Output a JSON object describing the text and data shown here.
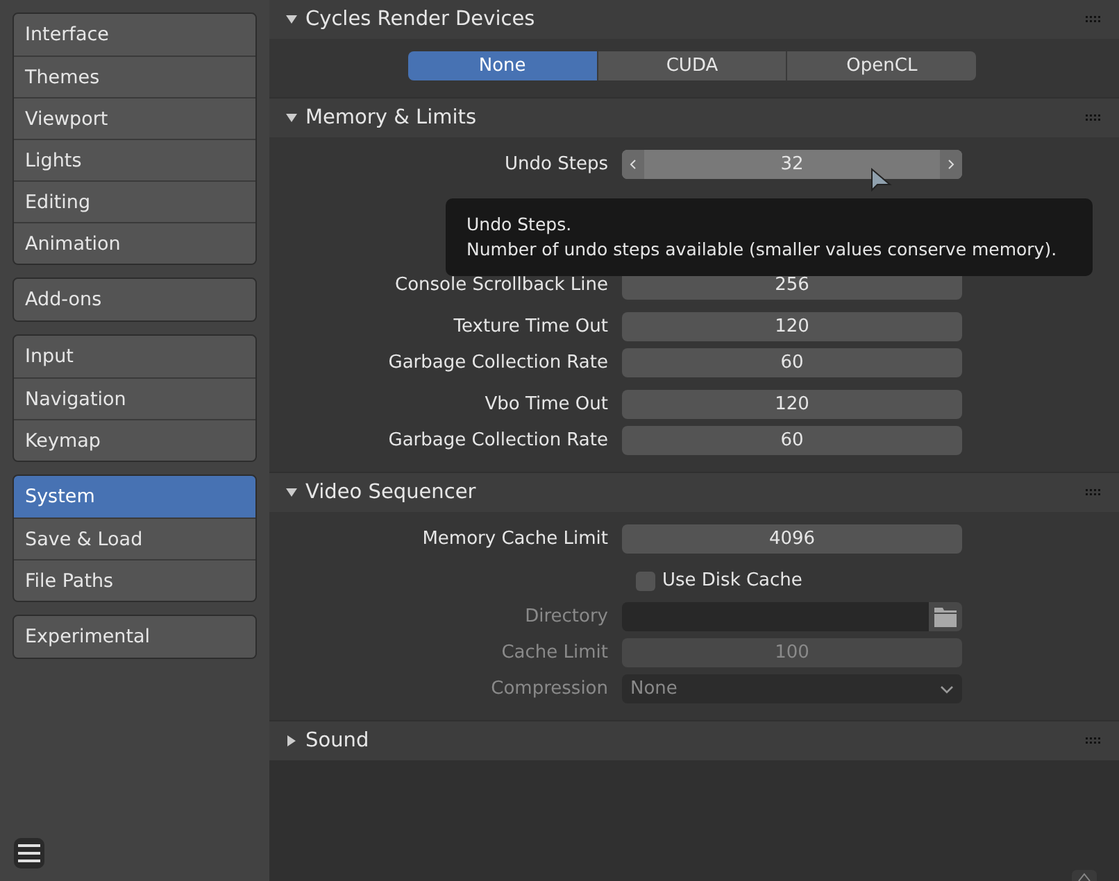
{
  "sidebar": {
    "groups": [
      [
        {
          "label": "Interface",
          "selected": false
        },
        {
          "label": "Themes",
          "selected": false
        },
        {
          "label": "Viewport",
          "selected": false
        },
        {
          "label": "Lights",
          "selected": false
        },
        {
          "label": "Editing",
          "selected": false
        },
        {
          "label": "Animation",
          "selected": false
        }
      ],
      [
        {
          "label": "Add-ons",
          "selected": false
        }
      ],
      [
        {
          "label": "Input",
          "selected": false
        },
        {
          "label": "Navigation",
          "selected": false
        },
        {
          "label": "Keymap",
          "selected": false
        }
      ],
      [
        {
          "label": "System",
          "selected": true
        },
        {
          "label": "Save & Load",
          "selected": false
        },
        {
          "label": "File Paths",
          "selected": false
        }
      ],
      [
        {
          "label": "Experimental",
          "selected": false
        }
      ]
    ]
  },
  "panels": [
    {
      "title": "Cycles Render Devices",
      "expanded": true,
      "groups": [
        [
          {
            "kind": "segmented",
            "options": [
              {
                "label": "None",
                "selected": true
              },
              {
                "label": "CUDA",
                "selected": false
              },
              {
                "label": "OpenCL",
                "selected": false
              }
            ]
          }
        ]
      ]
    },
    {
      "title": "Memory & Limits",
      "expanded": true,
      "groups": [
        [
          {
            "kind": "number",
            "label": "Undo Steps",
            "value": "32",
            "hovered": true,
            "disabled": false
          }
        ],
        [
          {
            "kind": "number",
            "label": "Console Scrollback Line",
            "value": "256",
            "hovered": false,
            "disabled": false
          }
        ],
        [
          {
            "kind": "number",
            "label": "Texture Time Out",
            "value": "120",
            "hovered": false,
            "disabled": false
          },
          {
            "kind": "number",
            "label": "Garbage Collection Rate",
            "value": "60",
            "hovered": false,
            "disabled": false
          }
        ],
        [
          {
            "kind": "number",
            "label": "Vbo Time Out",
            "value": "120",
            "hovered": false,
            "disabled": false
          },
          {
            "kind": "number",
            "label": "Garbage Collection Rate",
            "value": "60",
            "hovered": false,
            "disabled": false
          }
        ]
      ]
    },
    {
      "title": "Video Sequencer",
      "expanded": true,
      "groups": [
        [
          {
            "kind": "number",
            "label": "Memory Cache Limit",
            "value": "4096",
            "hovered": false,
            "disabled": false
          }
        ],
        [
          {
            "kind": "checkbox",
            "label": "Use Disk Cache",
            "checked": false,
            "disabled": false
          },
          {
            "kind": "file",
            "label": "Directory",
            "disabled": true
          },
          {
            "kind": "number",
            "label": "Cache Limit",
            "value": "100",
            "hovered": false,
            "disabled": true
          },
          {
            "kind": "dropdown",
            "label": "Compression",
            "value": "None",
            "disabled": true
          }
        ]
      ]
    },
    {
      "title": "Sound",
      "expanded": false
    }
  ],
  "tooltip": {
    "title": "Undo Steps.",
    "text": "Number of undo steps available (smaller values conserve memory)."
  }
}
